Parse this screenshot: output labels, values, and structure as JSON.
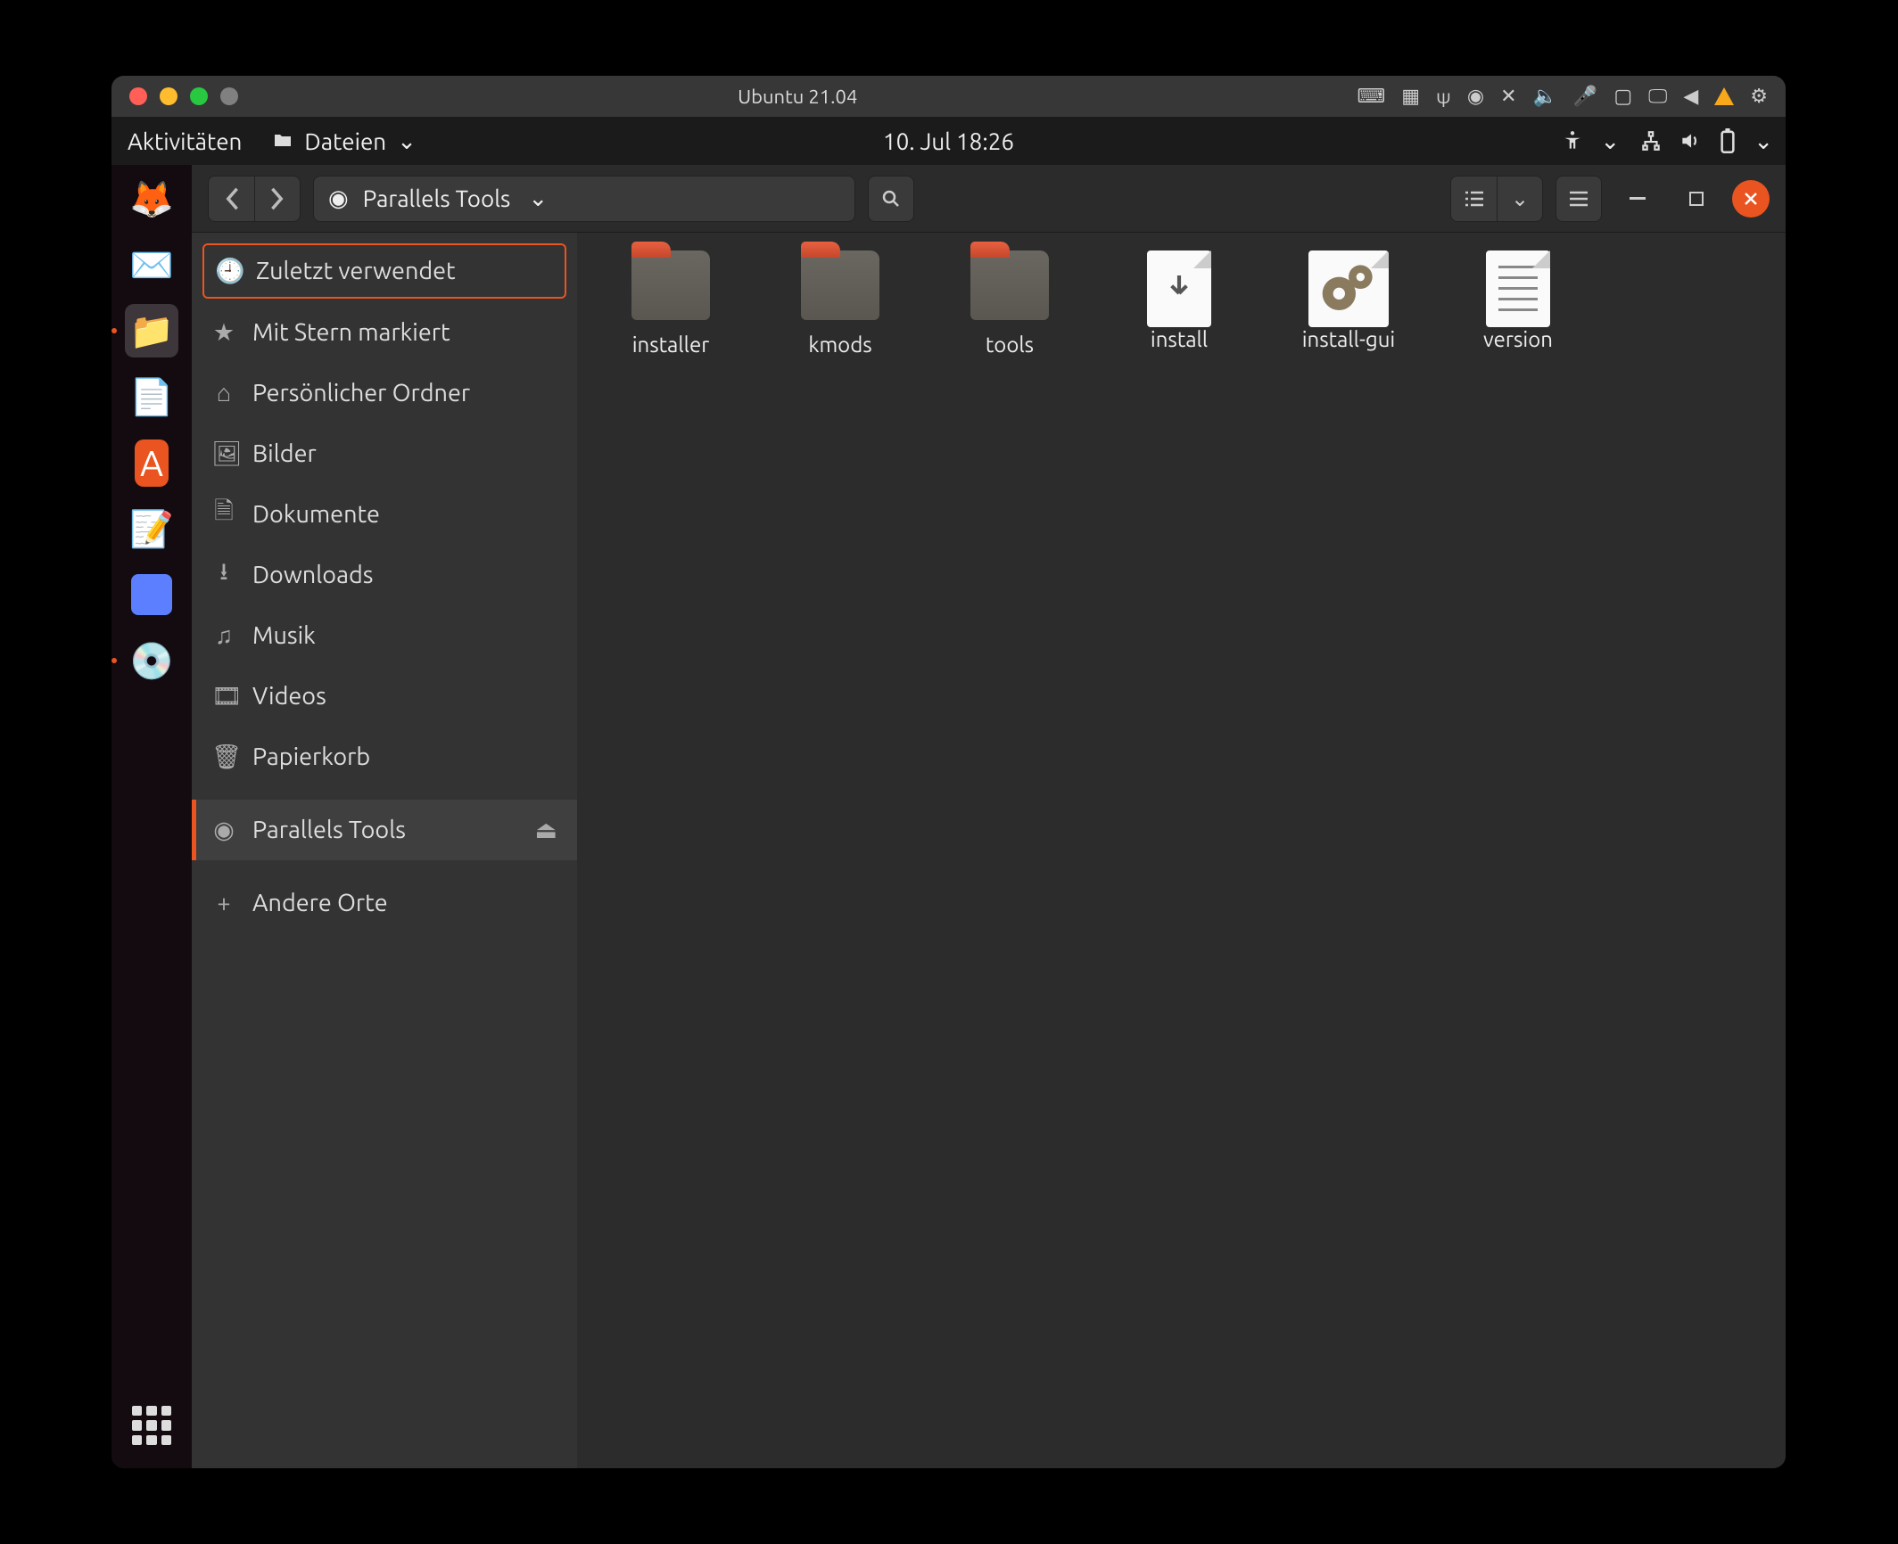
{
  "vm": {
    "title": "Ubuntu  21.04"
  },
  "gnome": {
    "activities": "Aktivitäten",
    "appmenu": "Dateien",
    "datetime": "10. Jul  18:26"
  },
  "dock": {
    "items": [
      {
        "name": "firefox",
        "glyph": "🦊"
      },
      {
        "name": "thunderbird",
        "glyph": "✉️"
      },
      {
        "name": "files",
        "glyph": "📁",
        "active": true
      },
      {
        "name": "libreoffice-writer",
        "glyph": "📄"
      },
      {
        "name": "ubuntu-software",
        "glyph": "🛍️"
      },
      {
        "name": "text-editor",
        "glyph": "📝"
      },
      {
        "name": "screenshot",
        "glyph": "🟦"
      },
      {
        "name": "cd-parallels-tools",
        "glyph": "💿",
        "running": true
      }
    ]
  },
  "nautilus": {
    "path": "Parallels Tools",
    "sidebar": [
      {
        "icon": "🕘",
        "label": "Zuletzt verwendet",
        "top_selected": true
      },
      {
        "icon": "★",
        "label": "Mit Stern markiert"
      },
      {
        "icon": "⌂",
        "label": "Persönlicher Ordner"
      },
      {
        "icon": "🖼",
        "label": "Bilder"
      },
      {
        "icon": "🗎",
        "label": "Dokumente"
      },
      {
        "icon": "⭳",
        "label": "Downloads"
      },
      {
        "icon": "♫",
        "label": "Musik"
      },
      {
        "icon": "🎞",
        "label": "Videos"
      },
      {
        "icon": "🗑",
        "label": "Papierkorb"
      },
      {
        "icon": "◉",
        "label": "Parallels Tools",
        "current": true,
        "eject": true
      },
      {
        "icon": "+",
        "label": "Andere Orte"
      }
    ],
    "files": [
      {
        "type": "folder",
        "label": "installer"
      },
      {
        "type": "folder",
        "label": "kmods"
      },
      {
        "type": "folder",
        "label": "tools"
      },
      {
        "type": "script",
        "label": "install"
      },
      {
        "type": "desktop",
        "label": "install-gui"
      },
      {
        "type": "text",
        "label": "version"
      }
    ]
  }
}
